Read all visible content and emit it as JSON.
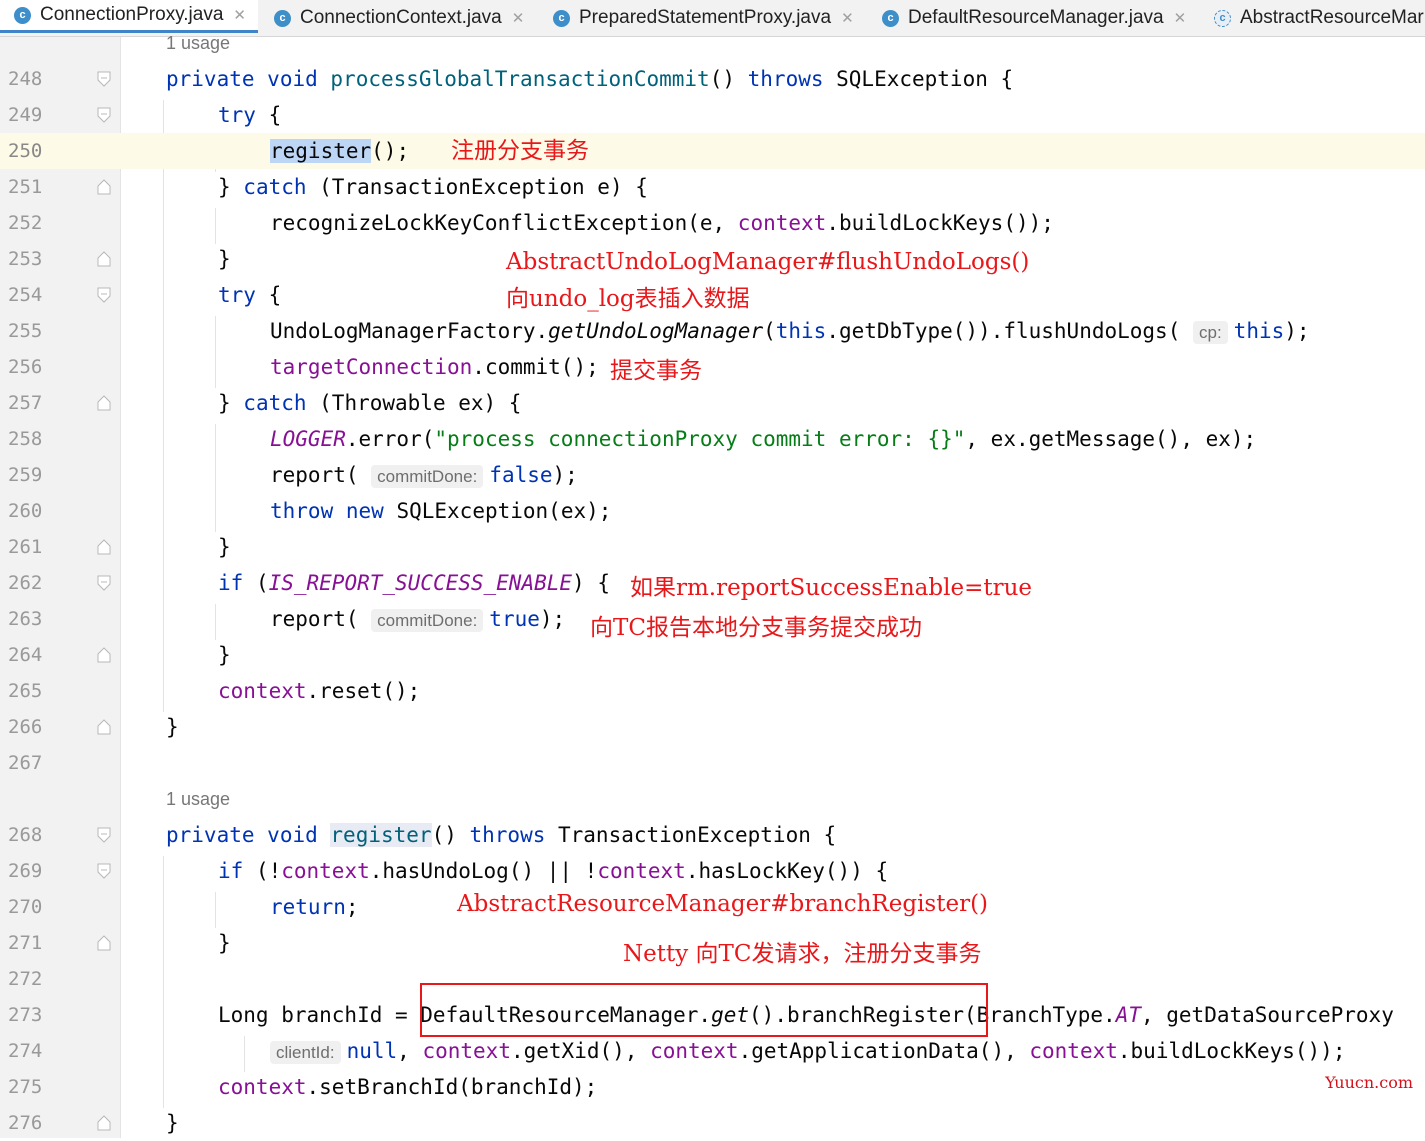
{
  "tabs": [
    {
      "label": "ConnectionProxy.java",
      "icon": "class-icon",
      "active": true
    },
    {
      "label": "ConnectionContext.java",
      "icon": "class-icon"
    },
    {
      "label": "PreparedStatementProxy.java",
      "icon": "class-icon"
    },
    {
      "label": "DefaultResourceManager.java",
      "icon": "class-icon"
    },
    {
      "label": "AbstractResourceMar",
      "icon": "abstract-class-icon"
    }
  ],
  "usage_hint": "1 usage",
  "line_numbers": [
    "248",
    "249",
    "250",
    "251",
    "252",
    "253",
    "254",
    "255",
    "256",
    "257",
    "258",
    "259",
    "260",
    "261",
    "262",
    "263",
    "264",
    "265",
    "266",
    "267",
    "268",
    "269",
    "270",
    "271",
    "272",
    "273",
    "274",
    "275",
    "276"
  ],
  "code": {
    "private": "private",
    "void": "void",
    "throws": "throws",
    "try": "try",
    "catch": "catch",
    "if": "if",
    "this": "this",
    "throw": "throw",
    "new": "new",
    "return": "return",
    "false": "false",
    "true": "true",
    "null": "null",
    "processGlobalTransactionCommit": "processGlobalTransactionCommit",
    "register_call": "register",
    "register_decl": "register",
    "context": "context",
    "targetConnection": "targetConnection",
    "LOGGER": "LOGGER",
    "IS_REPORT_SUCCESS_ENABLE": "IS_REPORT_SUCCESS_ENABLE",
    "getUndoLogManager": "getUndoLogManager",
    "AT": "AT",
    "get": "get",
    "error_string": "\"process connectionProxy commit error: {}\"",
    "hint_cp": "cp:",
    "hint_commitDone": "commitDone:",
    "hint_clientId": "clientId:"
  },
  "annotations": {
    "register_branch": "注册分支事务",
    "flush_undo_logs": "AbstractUndoLogManager#flushUndoLogs()",
    "insert_undo_log": "向undo_log表插入数据",
    "commit_tx": "提交事务",
    "if_report": "如果rm.reportSuccessEnable=true",
    "report_tc": "向TC报告本地分支事务提交成功",
    "branch_register": "AbstractResourceManager#branchRegister()",
    "netty_request": "Netty 向TC发请求，注册分支事务"
  },
  "watermark": "Yuucn.com"
}
